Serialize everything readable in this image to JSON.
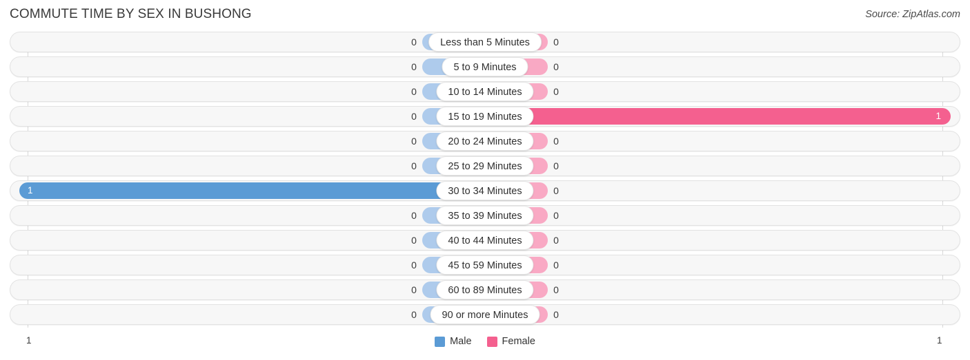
{
  "header": {
    "title": "COMMUTE TIME BY SEX IN BUSHONG",
    "source": "Source: ZipAtlas.com"
  },
  "legend": {
    "male_label": "Male",
    "female_label": "Female",
    "male_color": "#5b9bd5",
    "female_color": "#f4608f",
    "male_track_color": "#aecbec",
    "female_track_color": "#f9a9c4"
  },
  "axis": {
    "min_label": "1",
    "max_label": "1"
  },
  "chart_data": {
    "type": "bar",
    "title": "COMMUTE TIME BY SEX IN BUSHONG",
    "subtitle": "Source: ZipAtlas.com",
    "orientation": "horizontal-diverging",
    "xlabel": "",
    "ylabel": "",
    "xlim": [
      1,
      1
    ],
    "grid": false,
    "legend_position": "bottom-center",
    "categories": [
      "Less than 5 Minutes",
      "5 to 9 Minutes",
      "10 to 14 Minutes",
      "15 to 19 Minutes",
      "20 to 24 Minutes",
      "25 to 29 Minutes",
      "30 to 34 Minutes",
      "35 to 39 Minutes",
      "40 to 44 Minutes",
      "45 to 59 Minutes",
      "60 to 89 Minutes",
      "90 or more Minutes"
    ],
    "series": [
      {
        "name": "Male",
        "color": "#5b9bd5",
        "values": [
          0,
          0,
          0,
          0,
          0,
          0,
          1,
          0,
          0,
          0,
          0,
          0
        ]
      },
      {
        "name": "Female",
        "color": "#f4608f",
        "values": [
          0,
          0,
          0,
          1,
          0,
          0,
          0,
          0,
          0,
          0,
          0,
          0
        ]
      }
    ],
    "rows": [
      {
        "label": "Less than 5 Minutes",
        "male": "0",
        "female": "0",
        "male_pct": 0,
        "female_pct": 0
      },
      {
        "label": "5 to 9 Minutes",
        "male": "0",
        "female": "0",
        "male_pct": 0,
        "female_pct": 0
      },
      {
        "label": "10 to 14 Minutes",
        "male": "0",
        "female": "0",
        "male_pct": 0,
        "female_pct": 0
      },
      {
        "label": "15 to 19 Minutes",
        "male": "0",
        "female": "1",
        "male_pct": 0,
        "female_pct": 100
      },
      {
        "label": "20 to 24 Minutes",
        "male": "0",
        "female": "0",
        "male_pct": 0,
        "female_pct": 0
      },
      {
        "label": "25 to 29 Minutes",
        "male": "0",
        "female": "0",
        "male_pct": 0,
        "female_pct": 0
      },
      {
        "label": "30 to 34 Minutes",
        "male": "1",
        "female": "0",
        "male_pct": 100,
        "female_pct": 0
      },
      {
        "label": "35 to 39 Minutes",
        "male": "0",
        "female": "0",
        "male_pct": 0,
        "female_pct": 0
      },
      {
        "label": "40 to 44 Minutes",
        "male": "0",
        "female": "0",
        "male_pct": 0,
        "female_pct": 0
      },
      {
        "label": "45 to 59 Minutes",
        "male": "0",
        "female": "0",
        "male_pct": 0,
        "female_pct": 0
      },
      {
        "label": "60 to 89 Minutes",
        "male": "0",
        "female": "0",
        "male_pct": 0,
        "female_pct": 0
      },
      {
        "label": "90 or more Minutes",
        "male": "0",
        "female": "0",
        "male_pct": 0,
        "female_pct": 0
      }
    ]
  }
}
